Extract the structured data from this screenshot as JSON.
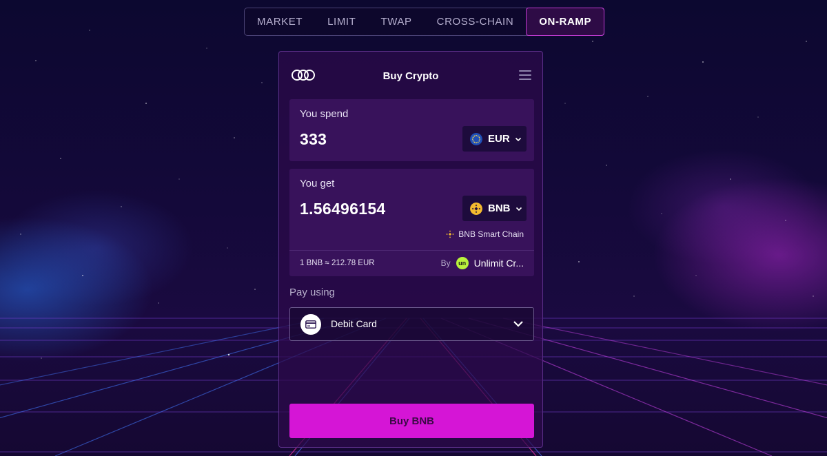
{
  "tabs": [
    {
      "label": "MARKET"
    },
    {
      "label": "LIMIT"
    },
    {
      "label": "TWAP"
    },
    {
      "label": "CROSS-CHAIN"
    },
    {
      "label": "ON-RAMP",
      "active": true
    }
  ],
  "card": {
    "title": "Buy Crypto"
  },
  "spend": {
    "label": "You spend",
    "amount": "333",
    "currency": "EUR",
    "currency_icon": "eu-flag-icon"
  },
  "get": {
    "label": "You get",
    "amount": "1.56496154",
    "currency": "BNB",
    "currency_icon": "bnb-icon",
    "chain": "BNB Smart Chain",
    "rate": "1 BNB ≈ 212.78 EUR",
    "by_label": "By",
    "provider": "Unlimit Cr...",
    "provider_icon_text": "un"
  },
  "pay": {
    "label": "Pay using",
    "method": "Debit Card",
    "method_icon": "credit-card-icon"
  },
  "buy_button": {
    "label": "Buy BNB"
  },
  "colors": {
    "accent": "#d515d6",
    "active_tab_border": "#c03ad0",
    "bnb": "#f3ba2f",
    "provider": "#b9f23c",
    "eur": "#1f4fb8"
  }
}
